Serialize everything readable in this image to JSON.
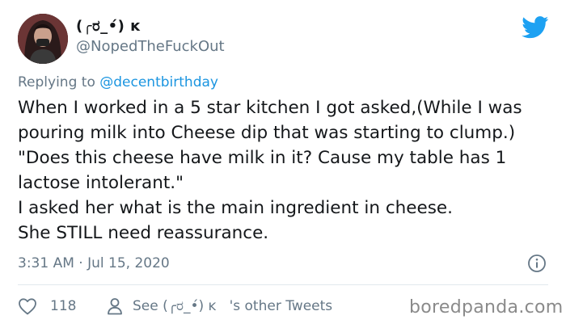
{
  "author": {
    "display_name": "(╭ರ_•́) ĸ ͏ ͏ ͏",
    "handle": "@NopedTheFuckOut"
  },
  "reply": {
    "prefix": "Replying to ",
    "mention": "@decentbirthday"
  },
  "tweet": {
    "text": "When I worked in a 5 star kitchen I got asked,(While I was pouring milk into Cheese dip that was starting to clump.)  \"Does this cheese have milk in it? Cause my table has 1 lactose intolerant.\"\nI asked her what is the main ingredient in cheese.\nShe STILL need reassurance.",
    "timestamp": "3:31 AM · Jul 15, 2020"
  },
  "actions": {
    "like_count": "118",
    "see_other_tweets": "See (╭ರ_•́) ĸ ͏ ͏ ͏'s other Tweets"
  },
  "watermark": "boredpanda.com",
  "icons": {
    "brand": "twitter-bird-icon",
    "info": "info-icon",
    "like": "heart-icon",
    "profile": "person-icon"
  },
  "colors": {
    "twitter_blue": "#1da1f2",
    "mention_blue": "#1b95e0",
    "secondary_text": "#657786",
    "divider": "#e1e8ed"
  }
}
